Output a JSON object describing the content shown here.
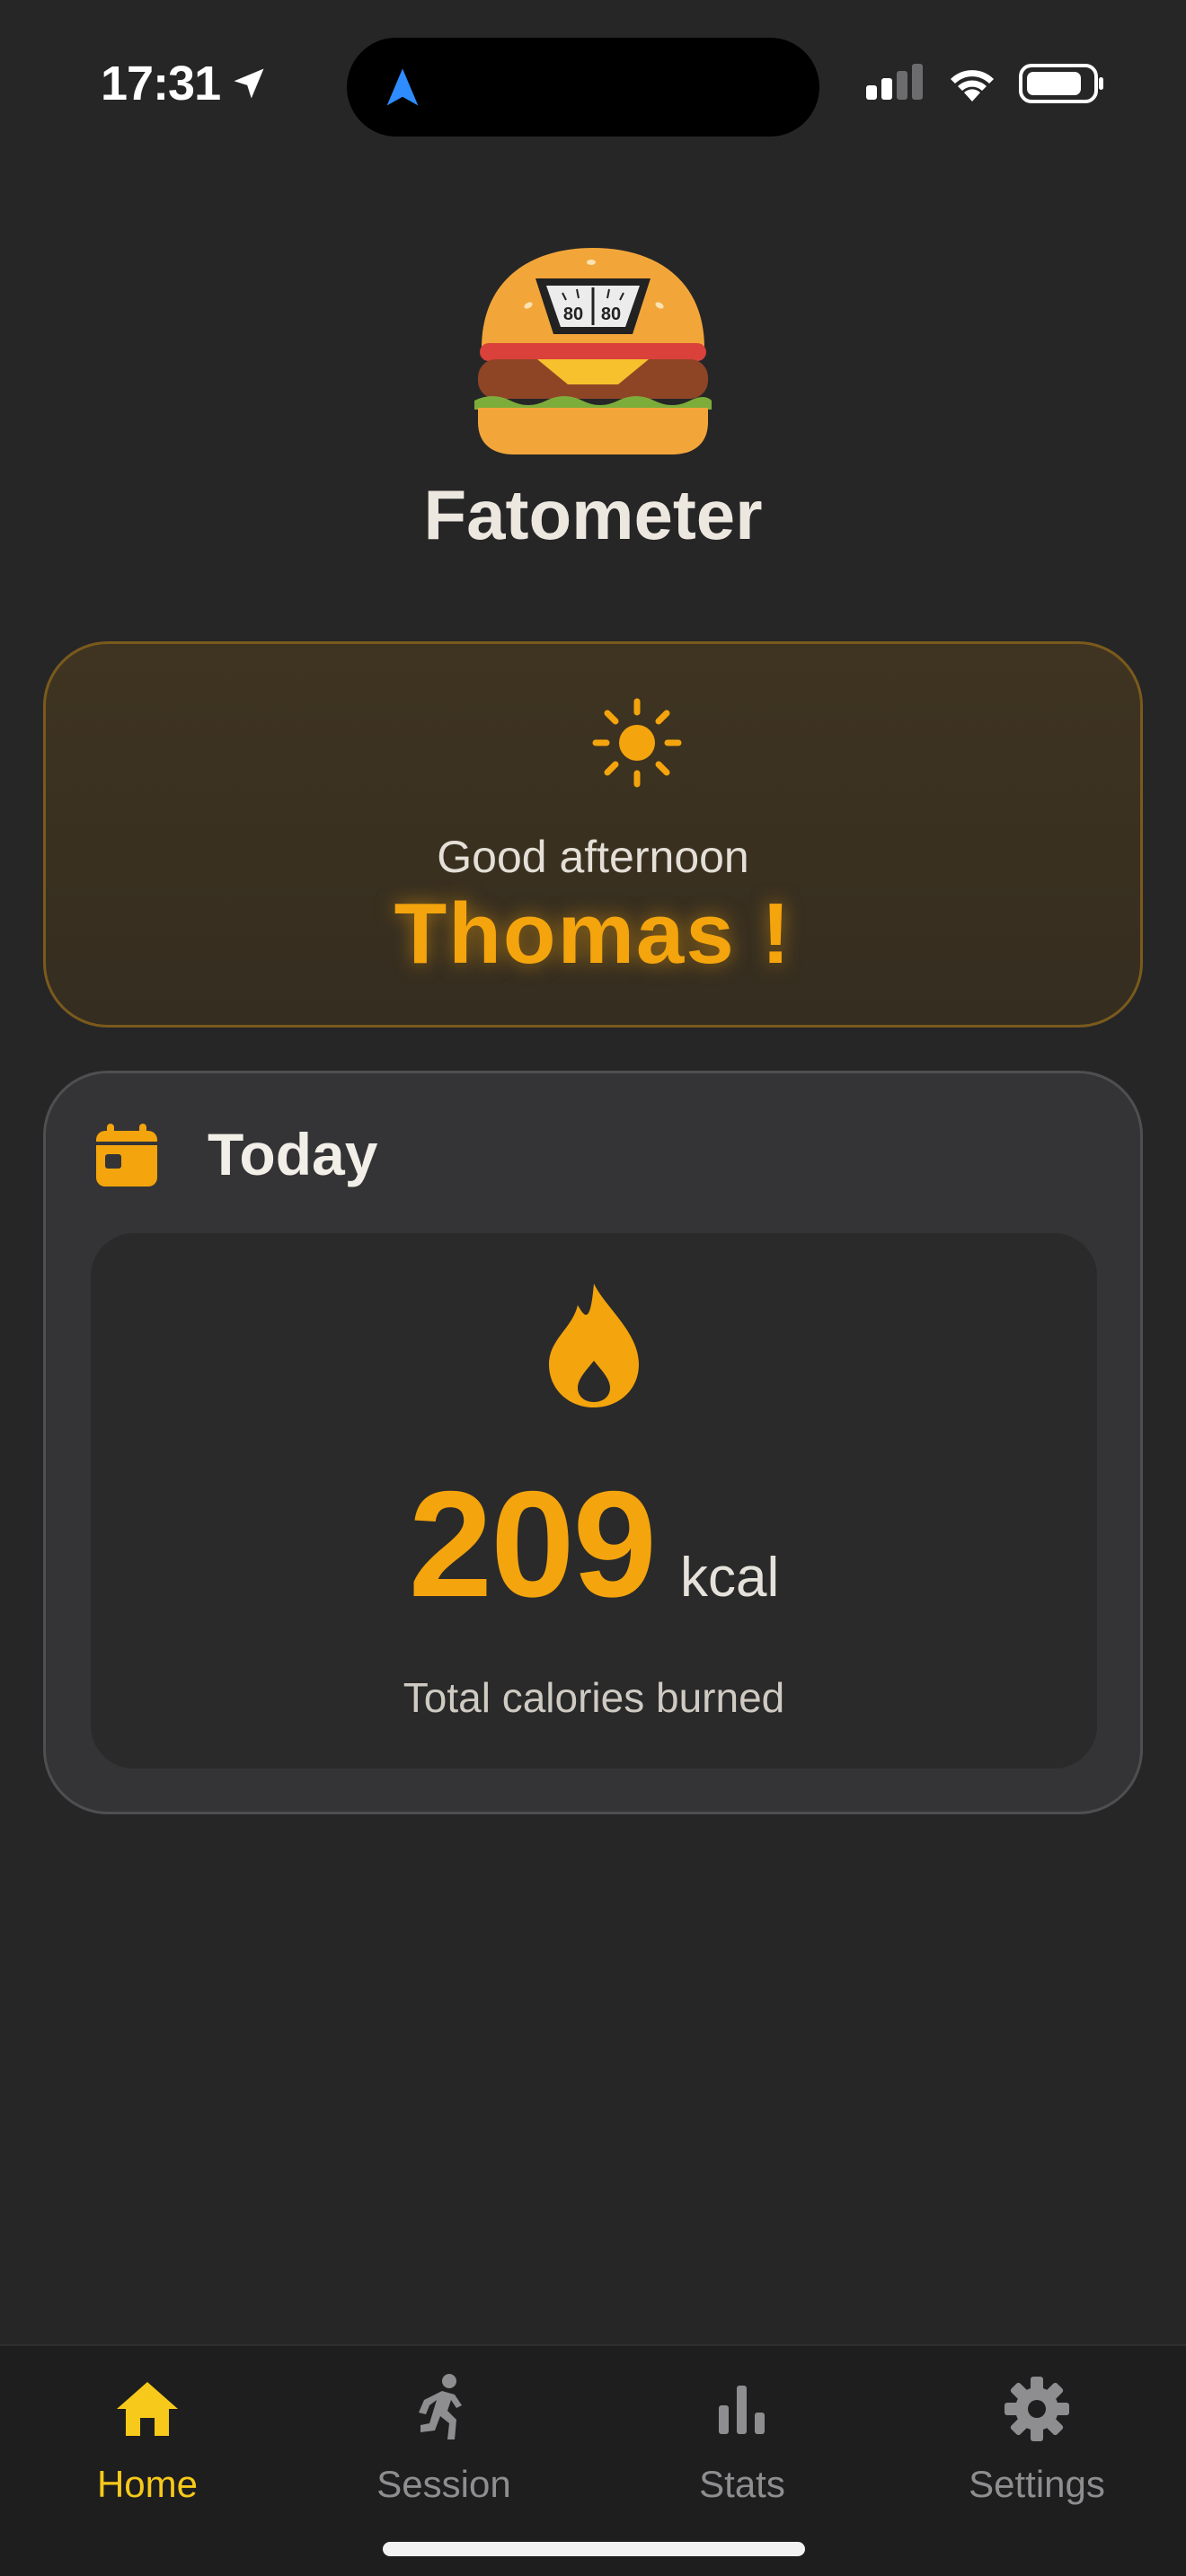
{
  "status_bar": {
    "time": "17:31",
    "location_icon": "location-arrow-icon",
    "signal_icon": "cellular-signal-icon",
    "wifi_icon": "wifi-icon",
    "battery_icon": "battery-icon"
  },
  "app": {
    "title": "Fatometer",
    "logo_icon": "burger-scale-icon",
    "logo_scale_left": "80",
    "logo_scale_right": "80"
  },
  "greeting": {
    "icon": "sun-icon",
    "message": "Good afternoon",
    "name": "Thomas !"
  },
  "today": {
    "icon": "calendar-icon",
    "title": "Today",
    "flame_icon": "flame-icon",
    "calories_value": "209",
    "calories_unit": "kcal",
    "calories_label": "Total calories burned"
  },
  "tabbar": {
    "tabs": [
      {
        "label": "Home",
        "icon": "home-icon",
        "active": true
      },
      {
        "label": "Session",
        "icon": "running-icon",
        "active": false
      },
      {
        "label": "Stats",
        "icon": "bar-chart-icon",
        "active": false
      },
      {
        "label": "Settings",
        "icon": "gear-icon",
        "active": false
      }
    ]
  },
  "colors": {
    "background": "#262627",
    "accent": "#f4a40c",
    "tab_active": "#f7c91a",
    "tab_inactive": "#8e8e90"
  }
}
